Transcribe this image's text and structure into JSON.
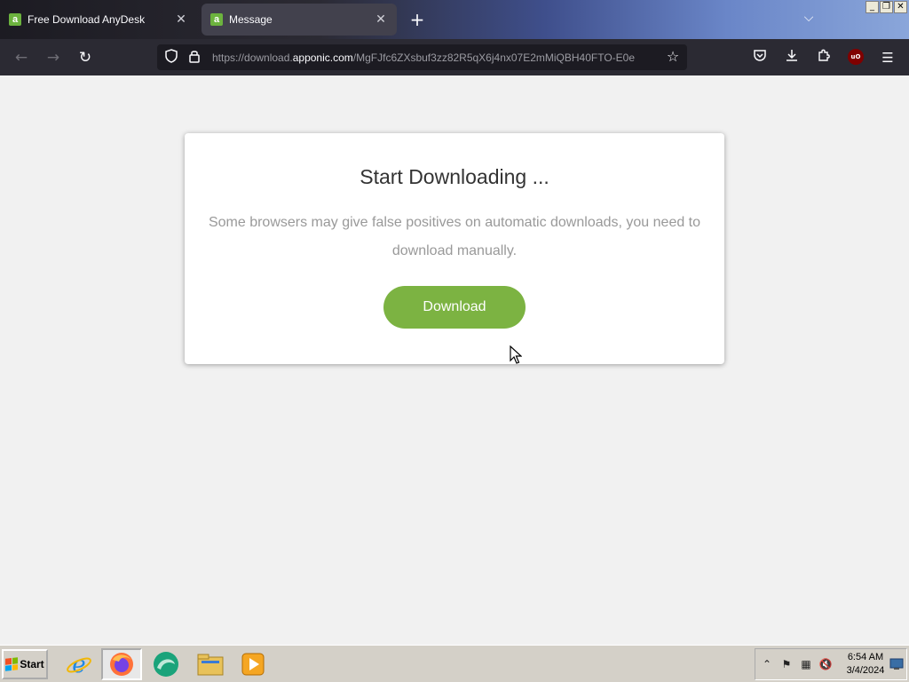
{
  "browser": {
    "tabs": [
      {
        "label": "Free Download AnyDesk",
        "favicon": "a",
        "active": false
      },
      {
        "label": "Message",
        "favicon": "a",
        "active": true
      }
    ],
    "url": {
      "prefix": "https://download.",
      "domain": "apponic.com",
      "path": "/MgFJfc6ZXsbuf3zz82R5qX6j4nx07E2mMiQBH40FTO-E0e"
    },
    "window_controls": {
      "minimize": "_",
      "restore": "❐",
      "close": "✕"
    },
    "extension_badge": "uO"
  },
  "page": {
    "title": "Start Downloading ...",
    "description": "Some browsers may give false positives on automatic downloads, you need to download manually.",
    "download_label": "Download",
    "button_color": "#7cb342"
  },
  "taskbar": {
    "start_label": "Start",
    "apps": [
      "internet-explorer-icon",
      "firefox-icon",
      "browser-icon",
      "file-explorer-icon",
      "media-player-icon"
    ],
    "time": "6:54 AM",
    "date": "3/4/2024"
  },
  "colors": {
    "toolbar_bg": "#2b2a33",
    "urlbar_bg": "#1c1b22",
    "page_bg": "#f1f1f1",
    "accent_green": "#7cb342"
  }
}
